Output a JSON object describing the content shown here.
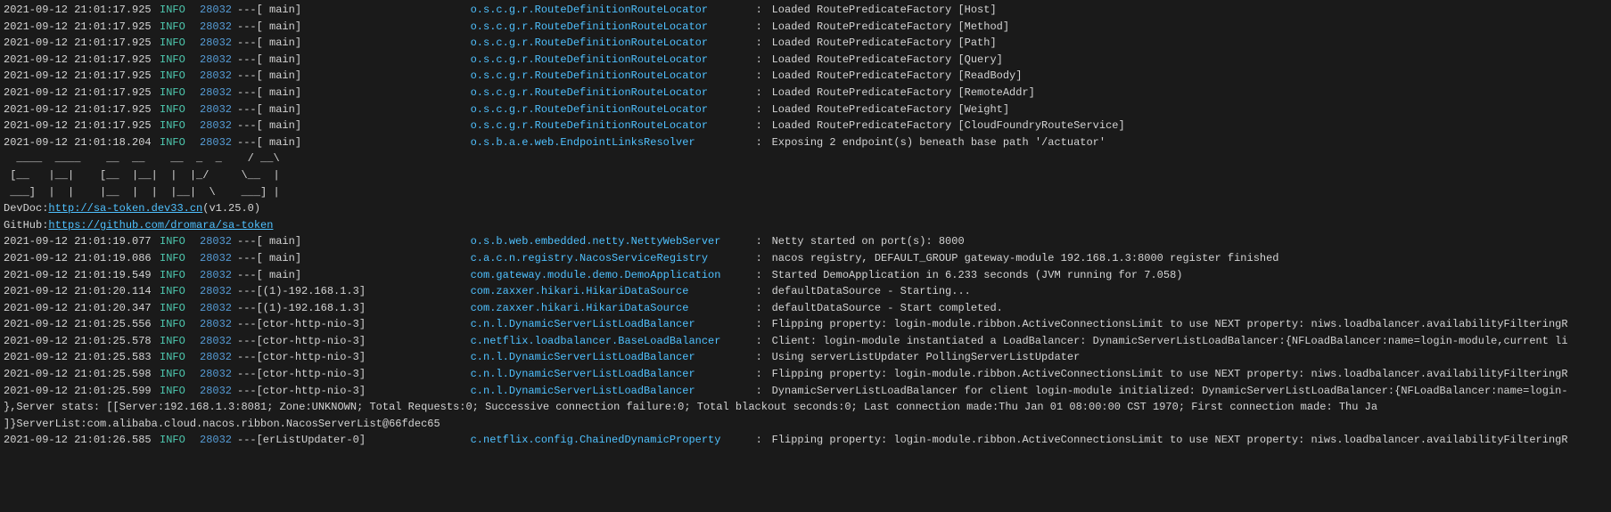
{
  "terminal": {
    "background": "#1a1a1a",
    "logLines": [
      {
        "timestamp": "2021-09-12 21:01:17.925",
        "level": "INFO",
        "pid": "28032",
        "separator": "---",
        "thread": "[                 main]",
        "logger": "o.s.c.g.r.RouteDefinitionRouteLocator",
        "colon": ":",
        "message": "Loaded RoutePredicateFactory [Host]"
      },
      {
        "timestamp": "2021-09-12 21:01:17.925",
        "level": "INFO",
        "pid": "28032",
        "separator": "---",
        "thread": "[                 main]",
        "logger": "o.s.c.g.r.RouteDefinitionRouteLocator",
        "colon": ":",
        "message": "Loaded RoutePredicateFactory [Method]"
      },
      {
        "timestamp": "2021-09-12 21:01:17.925",
        "level": "INFO",
        "pid": "28032",
        "separator": "---",
        "thread": "[                 main]",
        "logger": "o.s.c.g.r.RouteDefinitionRouteLocator",
        "colon": ":",
        "message": "Loaded RoutePredicateFactory [Path]"
      },
      {
        "timestamp": "2021-09-12 21:01:17.925",
        "level": "INFO",
        "pid": "28032",
        "separator": "---",
        "thread": "[                 main]",
        "logger": "o.s.c.g.r.RouteDefinitionRouteLocator",
        "colon": ":",
        "message": "Loaded RoutePredicateFactory [Query]"
      },
      {
        "timestamp": "2021-09-12 21:01:17.925",
        "level": "INFO",
        "pid": "28032",
        "separator": "---",
        "thread": "[                 main]",
        "logger": "o.s.c.g.r.RouteDefinitionRouteLocator",
        "colon": ":",
        "message": "Loaded RoutePredicateFactory [ReadBody]"
      },
      {
        "timestamp": "2021-09-12 21:01:17.925",
        "level": "INFO",
        "pid": "28032",
        "separator": "---",
        "thread": "[                 main]",
        "logger": "o.s.c.g.r.RouteDefinitionRouteLocator",
        "colon": ":",
        "message": "Loaded RoutePredicateFactory [RemoteAddr]"
      },
      {
        "timestamp": "2021-09-12 21:01:17.925",
        "level": "INFO",
        "pid": "28032",
        "separator": "---",
        "thread": "[                 main]",
        "logger": "o.s.c.g.r.RouteDefinitionRouteLocator",
        "colon": ":",
        "message": "Loaded RoutePredicateFactory [Weight]"
      },
      {
        "timestamp": "2021-09-12 21:01:17.925",
        "level": "INFO",
        "pid": "28032",
        "separator": "---",
        "thread": "[                 main]",
        "logger": "o.s.c.g.r.RouteDefinitionRouteLocator",
        "colon": ":",
        "message": "Loaded RoutePredicateFactory [CloudFoundryRouteService]"
      },
      {
        "timestamp": "2021-09-12 21:01:18.204",
        "level": "INFO",
        "pid": "28032",
        "separator": "---",
        "thread": "[                 main]",
        "logger": "o.s.b.a.e.web.EndpointLinksResolver",
        "colon": ":",
        "message": "Exposing 2 endpoint(s) beneath base path '/actuator'"
      }
    ],
    "asciiArt": [
      "  ____  ____    __  __    __  _  _    / __\\",
      " [__   |__|    [__  |__|  |  |_/     \\__  |",
      " ___]  |  |    |__  |  |  |__|  \\    ___] |"
    ],
    "devdoc": "DevDoc: ",
    "devdocLink": "http://sa-token.dev33.cn",
    "devdocVersion": " (v1.25.0)",
    "github": "GitHub: ",
    "githubLink": "https://github.com/dromara/sa-token",
    "afterAsciiLines": [
      {
        "timestamp": "2021-09-12 21:01:19.077",
        "level": "INFO",
        "pid": "28032",
        "separator": "---",
        "thread": "[                 main]",
        "logger": "o.s.b.web.embedded.netty.NettyWebServer",
        "colon": ":",
        "message": "Netty started on port(s): 8000"
      },
      {
        "timestamp": "2021-09-12 21:01:19.086",
        "level": "INFO",
        "pid": "28032",
        "separator": "---",
        "thread": "[                 main]",
        "logger": "c.a.c.n.registry.NacosServiceRegistry",
        "colon": ":",
        "message": "nacos registry, DEFAULT_GROUP gateway-module 192.168.1.3:8000 register finished"
      },
      {
        "timestamp": "2021-09-12 21:01:19.549",
        "level": "INFO",
        "pid": "28032",
        "separator": "---",
        "thread": "[                 main]",
        "logger": "com.gateway.module.demo.DemoApplication",
        "colon": ":",
        "message": "Started DemoApplication in 6.233 seconds (JVM running for 7.058)"
      },
      {
        "timestamp": "2021-09-12 21:01:20.114",
        "level": "INFO",
        "pid": "28032",
        "separator": "---",
        "thread": "[(1)-192.168.1.3]",
        "logger": "com.zaxxer.hikari.HikariDataSource",
        "colon": ":",
        "message": "defaultDataSource - Starting..."
      },
      {
        "timestamp": "2021-09-12 21:01:20.347",
        "level": "INFO",
        "pid": "28032",
        "separator": "---",
        "thread": "[(1)-192.168.1.3]",
        "logger": "com.zaxxer.hikari.HikariDataSource",
        "colon": ":",
        "message": "defaultDataSource - Start completed."
      },
      {
        "timestamp": "2021-09-12 21:01:25.556",
        "level": "INFO",
        "pid": "28032",
        "separator": "---",
        "thread": "[ctor-http-nio-3]",
        "logger": "c.n.l.DynamicServerListLoadBalancer",
        "colon": ":",
        "message": "Flipping property: login-module.ribbon.ActiveConnectionsLimit to use NEXT property: niws.loadbalancer.availabilityFilteringR"
      },
      {
        "timestamp": "2021-09-12 21:01:25.578",
        "level": "INFO",
        "pid": "28032",
        "separator": "---",
        "thread": "[ctor-http-nio-3]",
        "logger": "c.netflix.loadbalancer.BaseLoadBalancer",
        "colon": ":",
        "message": "Client: login-module instantiated a LoadBalancer: DynamicServerListLoadBalancer:{NFLoadBalancer:name=login-module,current li"
      },
      {
        "timestamp": "2021-09-12 21:01:25.583",
        "level": "INFO",
        "pid": "28032",
        "separator": "---",
        "thread": "[ctor-http-nio-3]",
        "logger": "c.n.l.DynamicServerListLoadBalancer",
        "colon": ":",
        "message": "Using serverListUpdater PollingServerListUpdater"
      },
      {
        "timestamp": "2021-09-12 21:01:25.598",
        "level": "INFO",
        "pid": "28032",
        "separator": "---",
        "thread": "[ctor-http-nio-3]",
        "logger": "c.n.l.DynamicServerListLoadBalancer",
        "colon": ":",
        "message": "Flipping property: login-module.ribbon.ActiveConnectionsLimit to use NEXT property: niws.loadbalancer.availabilityFilteringR"
      },
      {
        "timestamp": "2021-09-12 21:01:25.599",
        "level": "INFO",
        "pid": "28032",
        "separator": "---",
        "thread": "[ctor-http-nio-3]",
        "logger": "c.n.l.DynamicServerListLoadBalancer",
        "colon": ":",
        "message": "DynamicServerListLoadBalancer for client login-module initialized: DynamicServerListLoadBalancer:{NFLoadBalancer:name=login-"
      },
      {
        "timestamp": "",
        "level": "",
        "pid": "",
        "separator": "",
        "thread": "",
        "logger": "",
        "colon": "",
        "message": "},Server stats: [[Server:192.168.1.3:8081;  Zone:UNKNOWN;  Total Requests:0;  Successive connection failure:0;  Total blackout seconds:0;  Last connection made:Thu Jan 01 08:00:00 CST 1970;  First connection made: Thu Ja"
      },
      {
        "timestamp": "",
        "level": "",
        "pid": "",
        "separator": "",
        "thread": "",
        "logger": "",
        "colon": "",
        "message": "]}ServerList:com.alibaba.cloud.nacos.ribbon.NacosServerList@66fdec65"
      },
      {
        "timestamp": "2021-09-12 21:01:26.585",
        "level": "INFO",
        "pid": "28032",
        "separator": "---",
        "thread": "[erListUpdater-0]",
        "logger": "c.netflix.config.ChainedDynamicProperty",
        "colon": ":",
        "message": "Flipping property: login-module.ribbon.ActiveConnectionsLimit to use NEXT property: niws.loadbalancer.availabilityFilteringR"
      }
    ]
  }
}
